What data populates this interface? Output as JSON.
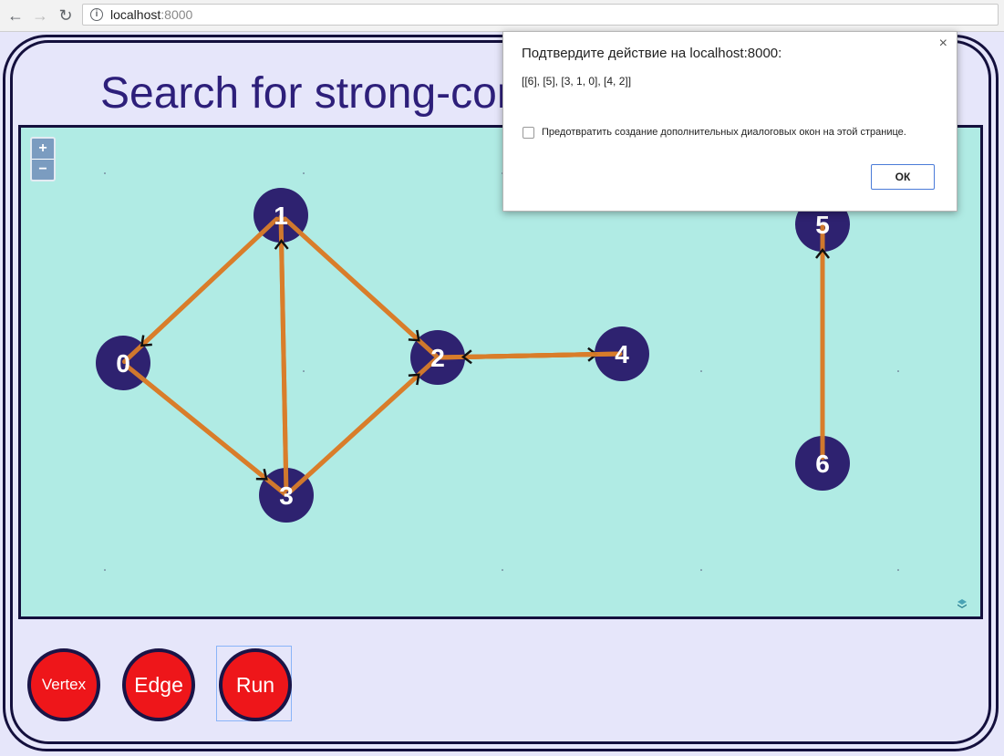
{
  "browser": {
    "url_host": "localhost",
    "url_port": ":8000"
  },
  "page": {
    "title": "Search for strong-cor"
  },
  "map": {
    "zoom_in_label": "+",
    "zoom_out_label": "−"
  },
  "graph": {
    "edge_color": "#d97d2a",
    "vertex_color": "#2e2270",
    "vertices": [
      {
        "id": "1",
        "label": "1"
      },
      {
        "id": "0",
        "label": "0"
      },
      {
        "id": "2",
        "label": "2"
      },
      {
        "id": "3",
        "label": "3"
      },
      {
        "id": "4",
        "label": "4"
      },
      {
        "id": "5",
        "label": "5"
      },
      {
        "id": "6",
        "label": "6"
      }
    ],
    "edges": [
      {
        "from": "1",
        "to": "0"
      },
      {
        "from": "1",
        "to": "2"
      },
      {
        "from": "3",
        "to": "1"
      },
      {
        "from": "0",
        "to": "3"
      },
      {
        "from": "3",
        "to": "2"
      },
      {
        "from": "2",
        "to": "4"
      },
      {
        "from": "4",
        "to": "2"
      },
      {
        "from": "6",
        "to": "5"
      }
    ]
  },
  "controls": {
    "vertex_label": "Vertex",
    "edge_label": "Edge",
    "run_label": "Run"
  },
  "dialog": {
    "title": "Подтвердите действие на localhost:8000:",
    "message": "[[6], [5], [3, 1, 0], [4, 2]]",
    "checkbox_label": "Предотвратить создание дополнительных диалоговых окон на этой странице.",
    "ok_label": "ОК",
    "close_label": "×"
  }
}
